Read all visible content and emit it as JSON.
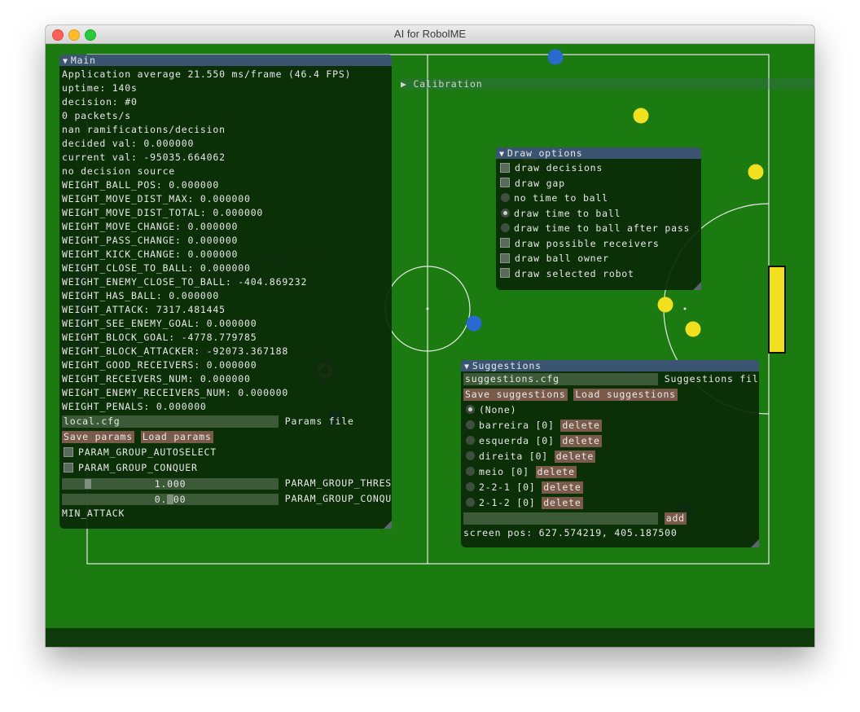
{
  "window": {
    "title": "AI for RobolME"
  },
  "colors": {
    "field": "#1b7a10",
    "panel_header": "#3a5472",
    "button": "#7a5a4a",
    "yellow_team": "#f0e020",
    "blue_team": "#2a6ad0"
  },
  "calibration": {
    "label": "Calibration"
  },
  "main": {
    "title": "Main",
    "lines": [
      "Application average 21.550 ms/frame (46.4 FPS)",
      "uptime: 140s",
      "decision: #0",
      "0 packets/s",
      "nan ramifications/decision",
      "decided val: 0.000000",
      "current val: -95035.664062",
      "no decision source",
      "WEIGHT_BALL_POS: 0.000000",
      "WEIGHT_MOVE_DIST_MAX: 0.000000",
      "WEIGHT_MOVE_DIST_TOTAL: 0.000000",
      "WEIGHT_MOVE_CHANGE: 0.000000",
      "WEIGHT_PASS_CHANGE: 0.000000",
      "WEIGHT_KICK_CHANGE: 0.000000",
      "WEIGHT_CLOSE_TO_BALL: 0.000000",
      "WEIGHT_ENEMY_CLOSE_TO_BALL: -404.869232",
      "WEIGHT_HAS_BALL: 0.000000",
      "WEIGHT_ATTACK: 7317.481445",
      "WEIGHT_SEE_ENEMY_GOAL: 0.000000",
      "WEIGHT_BLOCK_GOAL: -4778.779785",
      "WEIGHT_BLOCK_ATTACKER: -92073.367188",
      "WEIGHT_GOOD_RECEIVERS: 0.000000",
      "WEIGHT_RECEIVERS_NUM: 0.000000",
      "WEIGHT_ENEMY_RECEIVERS_NUM: 0.000000",
      "WEIGHT_PENALS: 0.000000"
    ],
    "params_file_value": "local.cfg",
    "params_file_label": "Params file",
    "save_params": "Save params",
    "load_params": "Load params",
    "autoselect_label": "PARAM_GROUP_AUTOSELECT",
    "conquer_label": "PARAM_GROUP_CONQUER",
    "slider1_value": "1.000",
    "slider1_label": "PARAM_GROUP_THRES",
    "slider2_value": "0.500",
    "slider2_label": "PARAM_GROUP_CONQU",
    "last_line": "MIN_ATTACK"
  },
  "draw_options": {
    "title": "Draw options",
    "items": [
      {
        "kind": "check",
        "label": "draw decisions"
      },
      {
        "kind": "check",
        "label": "draw gap"
      },
      {
        "kind": "radio",
        "label": "no time to ball"
      },
      {
        "kind": "radio-on",
        "label": "draw time to ball"
      },
      {
        "kind": "radio",
        "label": "draw time to ball after pass"
      },
      {
        "kind": "check",
        "label": "draw possible receivers"
      },
      {
        "kind": "check",
        "label": "draw ball owner"
      },
      {
        "kind": "check",
        "label": "draw selected robot"
      }
    ]
  },
  "suggestions": {
    "title": "Suggestions",
    "file_value": "suggestions.cfg",
    "file_label": "Suggestions fil",
    "save": "Save suggestions",
    "load": "Load suggestions",
    "none_label": "(None)",
    "delete_label": "delete",
    "entries": [
      "barreira [0]",
      "esquerda [0]",
      "direita [0]",
      "meio [0]",
      "2-2-1 [0]",
      "2-1-2 [0]"
    ],
    "add_label": "add",
    "screen_pos": "screen pos: 627.574219, 405.187500"
  }
}
